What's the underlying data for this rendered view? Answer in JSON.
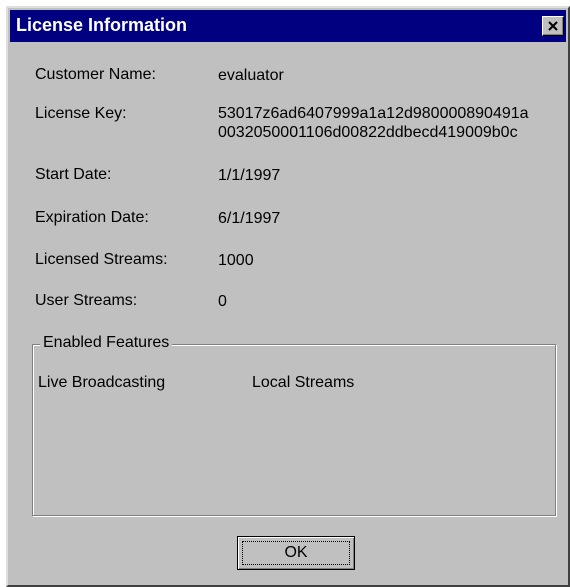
{
  "window": {
    "title": "License Information"
  },
  "fields": {
    "customer_name": {
      "label": "Customer Name:",
      "value": "evaluator"
    },
    "license_key": {
      "label": "License Key:",
      "value_line1": "53017z6ad6407999a1a12d980000890491a",
      "value_line2": "0032050001106d00822ddbecd419009b0c"
    },
    "start_date": {
      "label": "Start Date:",
      "value": "1/1/1997"
    },
    "expiration_date": {
      "label": "Expiration Date:",
      "value": "6/1/1997"
    },
    "licensed_streams": {
      "label": "Licensed Streams:",
      "value": "1000"
    },
    "user_streams": {
      "label": "User Streams:",
      "value": "0"
    }
  },
  "enabled_features": {
    "title": "Enabled Features",
    "items": [
      "Live Broadcasting",
      "Local Streams"
    ]
  },
  "buttons": {
    "ok_label": "OK"
  },
  "icons": {
    "close": "close-icon"
  },
  "colors": {
    "titlebar": "#000080",
    "dialog_face": "#c0c0c0",
    "title_text": "#ffffff"
  }
}
